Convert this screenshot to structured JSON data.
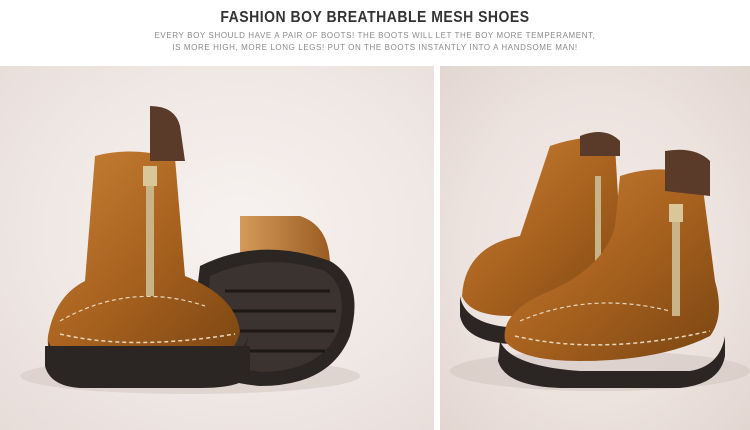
{
  "header": {
    "title": "FASHION BOY BREATHABLE MESH SHOES",
    "line1": "EVERY BOY SHOULD HAVE A PAIR OF BOOTS! THE BOOTS WILL LET THE BOY MORE TEMPERAMENT,",
    "line2": "IS MORE HIGH, MORE LONG LEGS! PUT ON THE BOOTS INSTANTLY INTO A HANDSOME MAN!"
  },
  "colors": {
    "leather": "#b06a22",
    "leather_dark": "#7a4512",
    "sole": "#2b2624",
    "lining": "#5a3a28",
    "zipper": "#c9b48a"
  },
  "photos": [
    {
      "name": "left-photo-boots-side-and-sole"
    },
    {
      "name": "right-photo-boots-pair-angle"
    }
  ]
}
